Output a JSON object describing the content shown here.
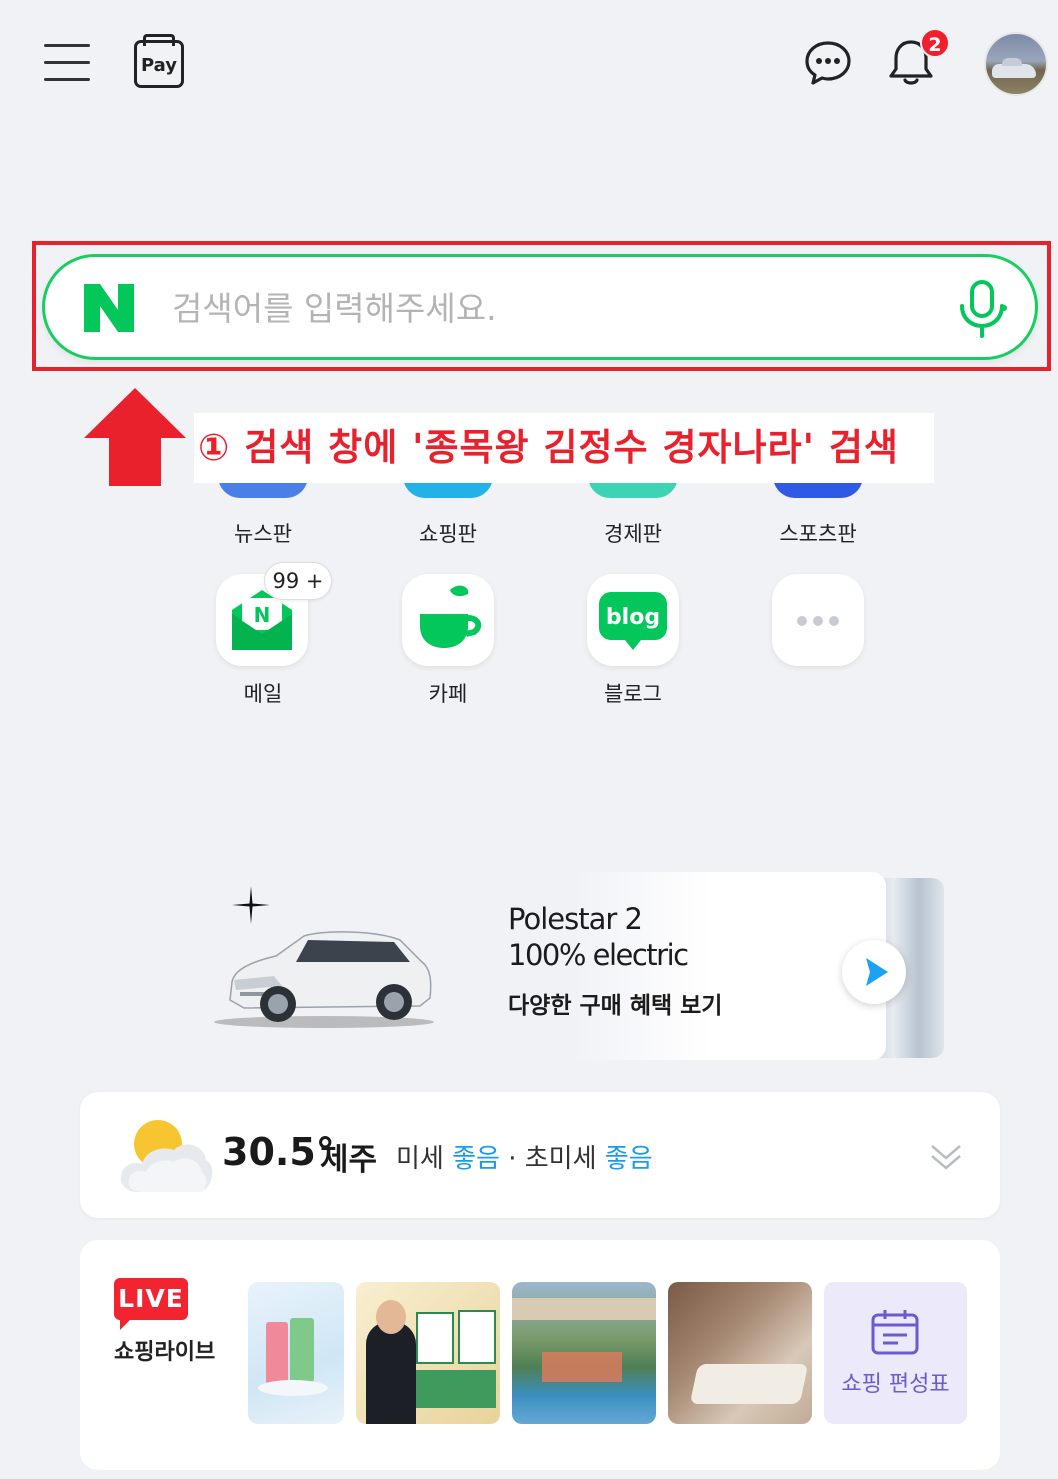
{
  "header": {
    "pay_label": "Pay",
    "notification_count": "2"
  },
  "search": {
    "placeholder": "검색어를 입력해주세요.",
    "logo_letter": "N"
  },
  "annotation": {
    "text": "① 검색 창에 '종목왕 김정수 경자나라' 검색",
    "color": "#e8212d"
  },
  "apps": {
    "row1": [
      {
        "label": "뉴스판",
        "icon": "news-icon"
      },
      {
        "label": "쇼핑판",
        "icon": "shopping-icon"
      },
      {
        "label": "경제판",
        "icon": "economy-icon"
      },
      {
        "label": "스포츠판",
        "icon": "sports-icon"
      }
    ],
    "row2": [
      {
        "label": "메일",
        "icon": "mail-icon",
        "badge": "99 +"
      },
      {
        "label": "카페",
        "icon": "cafe-icon"
      },
      {
        "label": "블로그",
        "icon": "blog-icon",
        "icon_text": "blog"
      },
      {
        "label": "",
        "icon": "more-icon"
      }
    ]
  },
  "ad": {
    "line1": "Polestar 2",
    "line2": "100% electric",
    "line3": "다양한 구매 혜택 보기"
  },
  "weather": {
    "temperature": "30.5°",
    "city": "제주",
    "fine_dust_label": "미세",
    "fine_dust_value": "좋음",
    "separator": "·",
    "ultrafine_dust_label": "초미세",
    "ultrafine_dust_value": "좋음"
  },
  "shopping_live": {
    "badge": "LIVE",
    "title": "쇼핑라이브",
    "schedule_label": "쇼핑 편성표"
  },
  "colors": {
    "naver_green": "#03c75a",
    "search_border": "#19ce60",
    "alert_red": "#f21e2c",
    "good_blue": "#1a9bf0"
  }
}
